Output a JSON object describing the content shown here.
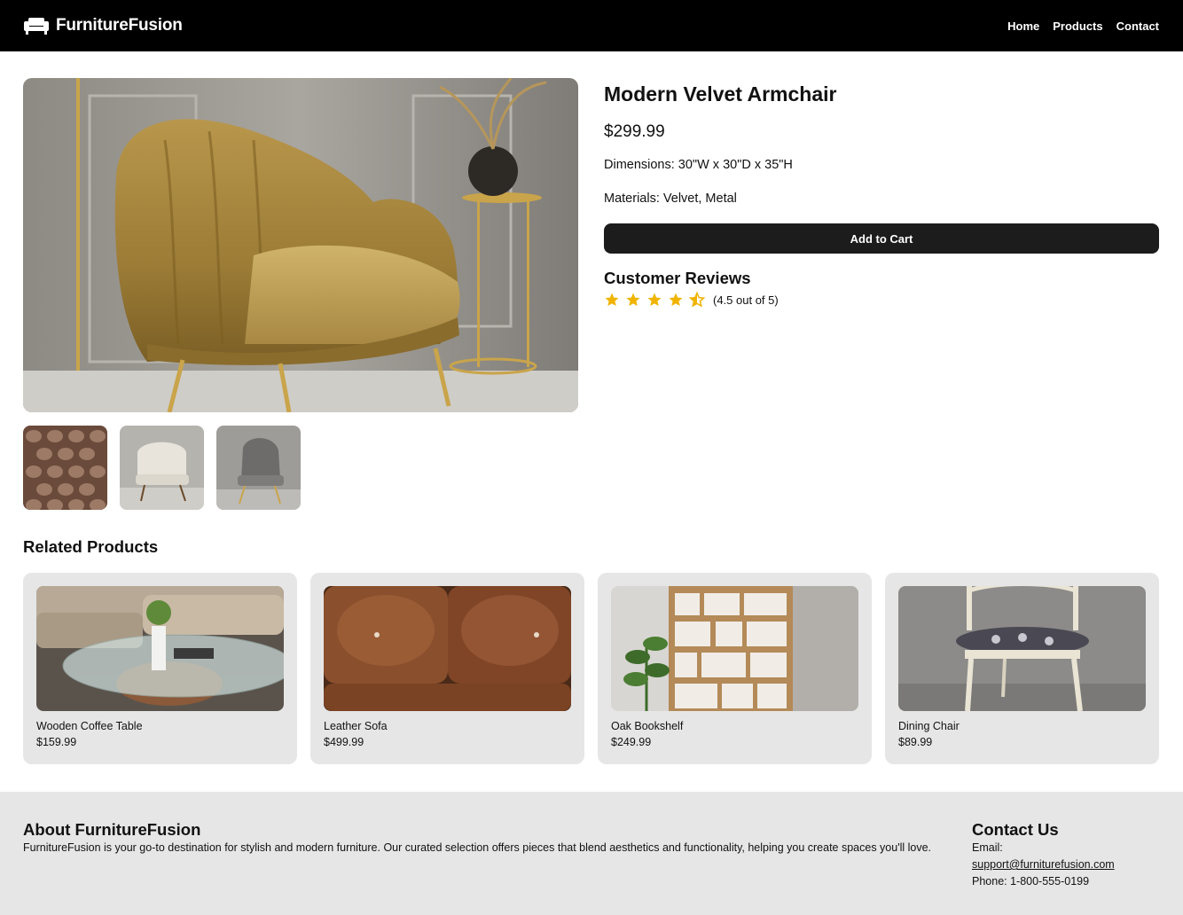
{
  "brand": {
    "name": "FurnitureFusion",
    "logo_icon": "sofa-icon"
  },
  "nav": {
    "items": [
      "Home",
      "Products",
      "Contact"
    ]
  },
  "product": {
    "title": "Modern Velvet Armchair",
    "price": "$299.99",
    "dimensions": "Dimensions: 30\"W x 30\"D x 35\"H",
    "materials": "Materials: Velvet, Metal",
    "add_to_cart": "Add to Cart",
    "main_image": "gold velvet armchair",
    "thumbnails": [
      "tufted brown leather closeup",
      "white armchair with wooden legs",
      "grey armchair with gold legs"
    ]
  },
  "reviews": {
    "title": "Customer Reviews",
    "rating": 4.5,
    "rating_text": "(4.5 out of 5)",
    "star_color": "#f0b400"
  },
  "related": {
    "title": "Related Products",
    "items": [
      {
        "name": "Wooden Coffee Table",
        "price": "$159.99"
      },
      {
        "name": "Leather Sofa",
        "price": "$499.99"
      },
      {
        "name": "Oak Bookshelf",
        "price": "$249.99"
      },
      {
        "name": "Dining Chair",
        "price": "$89.99"
      }
    ]
  },
  "footer": {
    "about_title": "About FurnitureFusion",
    "about_text": "FurnitureFusion is your go-to destination for stylish and modern furniture. Our curated selection offers pieces that blend aesthetics and functionality, helping you create spaces you'll love.",
    "contact_title": "Contact Us",
    "email_label": "Email:",
    "email": "support@furniturefusion.com",
    "phone": "Phone: 1-800-555-0199"
  }
}
